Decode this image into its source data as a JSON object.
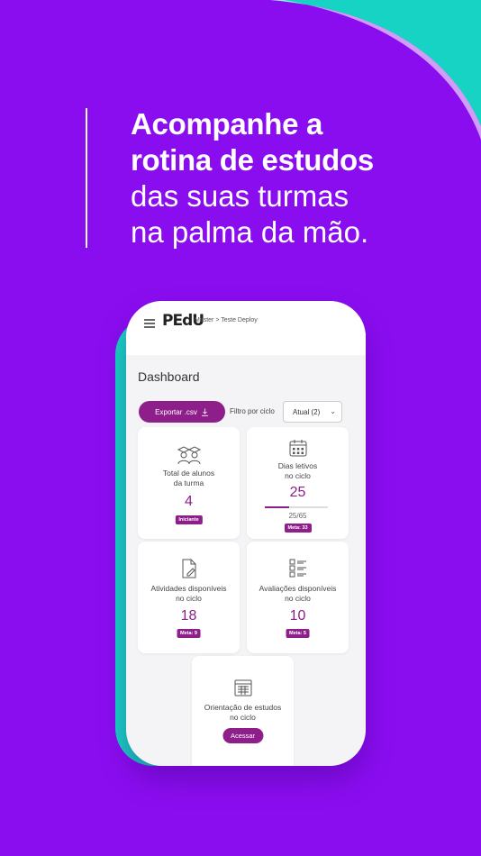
{
  "headline": {
    "line1": "Acompanhe a",
    "line2": "rotina de estudos",
    "line3": "das suas turmas",
    "line4": "na palma da mão."
  },
  "app": {
    "logo": "PEdU",
    "breadcrumb": "Master > Teste Deploy",
    "title": "Dashboard",
    "export_label": "Exportar .csv",
    "filter_label": "Filtro por ciclo",
    "filter_selected": "Atual (2)"
  },
  "cards": {
    "students": {
      "label1": "Total de alunos",
      "label2": "da turma",
      "value": "4",
      "badge": "Iniciante"
    },
    "days": {
      "label1": "Dias letivos",
      "label2": "no ciclo",
      "value": "25",
      "progress_text": "25/65",
      "progress": 0.385,
      "badge": "Meta: 33"
    },
    "activities": {
      "label1": "Atividades disponíveis",
      "label2": "no ciclo",
      "value": "18",
      "badge": "Meta: 9"
    },
    "evaluations": {
      "label1": "Avaliações disponíveis",
      "label2": "no ciclo",
      "value": "10",
      "badge": "Meta: 5"
    },
    "guidance": {
      "label1": "Orientação de estudos",
      "label2": "no ciclo",
      "button": "Acessar"
    }
  },
  "colors": {
    "background": "#8a0df0",
    "accent": "#8e1f8a",
    "teal": "#16d3c3"
  }
}
